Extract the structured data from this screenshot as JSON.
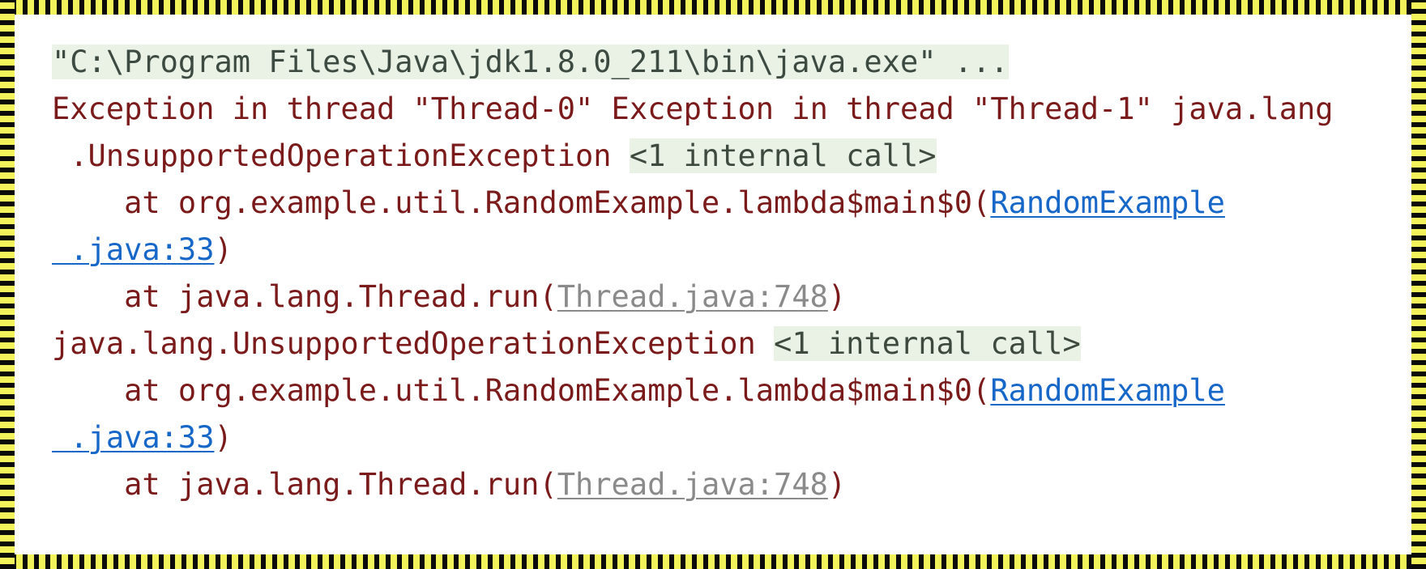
{
  "window": {
    "kind": "console-output",
    "border_style": "caution-tape",
    "colors": {
      "tape_yellow": "#f2f25a",
      "tape_black": "#0b0b0b",
      "console_bg": "#ffffff",
      "stacktrace_text": "#7a1a1a",
      "highlight_bg": "#e9f2e4",
      "highlight_text": "#3f4a3f",
      "link_blue": "#1667c8",
      "link_gray": "#8a8a8a"
    }
  },
  "console": {
    "command_line": {
      "text": "\"C:\\Program Files\\Java\\jdk1.8.0_211\\bin\\java.exe\" ...",
      "highlighted": true
    },
    "lines": [
      {
        "id": "line-1-command",
        "segments": [
          {
            "style": "hl-path",
            "text": "\"C:\\Program Files\\Java\\jdk1.8.0_211\\bin\\java.exe\" ..."
          }
        ]
      },
      {
        "id": "line-2-exception-headers",
        "segments": [
          {
            "style": "plain",
            "text": "Exception in thread \"Thread-0\" Exception in thread \"Thread-1\" java.lang"
          }
        ]
      },
      {
        "id": "line-3-exception-class",
        "segments": [
          {
            "style": "plain",
            "text": " .UnsupportedOperationException "
          },
          {
            "style": "hl",
            "text": "<1 internal call>"
          }
        ]
      },
      {
        "id": "line-4-frame-lambda",
        "segments": [
          {
            "style": "plain",
            "text": "    at org.example.util.RandomExample.lambda$main$0("
          },
          {
            "style": "link-blue",
            "text": "RandomExample"
          }
        ]
      },
      {
        "id": "line-5-frame-lambda-cont",
        "segments": [
          {
            "style": "link-blue",
            "text": " .java:33"
          },
          {
            "style": "plain",
            "text": ")"
          }
        ]
      },
      {
        "id": "line-6-frame-thread-run",
        "segments": [
          {
            "style": "plain",
            "text": "    at java.lang.Thread.run("
          },
          {
            "style": "link-gray",
            "text": "Thread.java:748"
          },
          {
            "style": "plain",
            "text": ")"
          }
        ]
      },
      {
        "id": "line-7-exception-class-2",
        "segments": [
          {
            "style": "plain",
            "text": "java.lang.UnsupportedOperationException "
          },
          {
            "style": "hl",
            "text": "<1 internal call>"
          }
        ]
      },
      {
        "id": "line-8-frame-lambda-2",
        "segments": [
          {
            "style": "plain",
            "text": "    at org.example.util.RandomExample.lambda$main$0("
          },
          {
            "style": "link-blue",
            "text": "RandomExample"
          }
        ]
      },
      {
        "id": "line-9-frame-lambda-2-cont",
        "segments": [
          {
            "style": "link-blue",
            "text": " .java:33"
          },
          {
            "style": "plain",
            "text": ")"
          }
        ]
      },
      {
        "id": "line-10-frame-thread-run-2",
        "segments": [
          {
            "style": "plain",
            "text": "    at java.lang.Thread.run("
          },
          {
            "style": "link-gray",
            "text": "Thread.java:748"
          },
          {
            "style": "plain",
            "text": ")"
          }
        ]
      }
    ]
  }
}
